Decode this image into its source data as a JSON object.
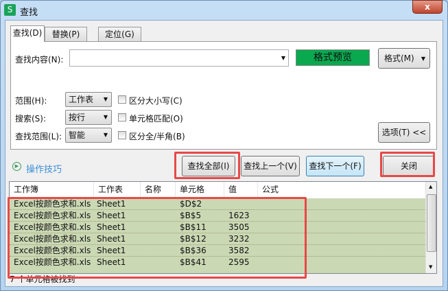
{
  "window": {
    "title": "查找",
    "logo": "S",
    "close": "x"
  },
  "tabs": [
    {
      "label": "查找(D)"
    },
    {
      "label": "替换(P)"
    },
    {
      "label": "定位(G)"
    }
  ],
  "find": {
    "label": "查找内容(N):",
    "value": "",
    "preview": "格式预览",
    "format_button": "格式(M)",
    "preview_color": "#0aa84f"
  },
  "options": [
    {
      "label": "范围(H):",
      "select": "工作表",
      "checkbox": "区分大小写(C)",
      "checked": false
    },
    {
      "label": "搜索(S):",
      "select": "按行",
      "checkbox": "单元格匹配(O)",
      "checked": false
    },
    {
      "label": "查找范围(L):",
      "select": "智能",
      "checkbox": "区分全/半角(B)",
      "checked": false
    }
  ],
  "options_button": "选项(T) <<",
  "help_link": "操作技巧",
  "buttons": {
    "find_all": "查找全部(I)",
    "find_prev": "查找上一个(V)",
    "find_next": "查找下一个(F)",
    "close": "关闭"
  },
  "table": {
    "headers": [
      "工作簿",
      "工作表",
      "名称",
      "单元格",
      "值",
      "公式"
    ],
    "rows": [
      [
        "Excel按颜色求和.xls",
        "Sheet1",
        "",
        "$D$2",
        "",
        ""
      ],
      [
        "Excel按颜色求和.xls",
        "Sheet1",
        "",
        "$B$5",
        "1623",
        ""
      ],
      [
        "Excel按颜色求和.xls",
        "Sheet1",
        "",
        "$B$11",
        "3505",
        ""
      ],
      [
        "Excel按颜色求和.xls",
        "Sheet1",
        "",
        "$B$12",
        "3232",
        ""
      ],
      [
        "Excel按颜色求和.xls",
        "Sheet1",
        "",
        "$B$36",
        "3582",
        ""
      ],
      [
        "Excel按颜色求和.xls",
        "Sheet1",
        "",
        "$B$41",
        "2595",
        ""
      ]
    ]
  },
  "status": "7 个单元格被找到",
  "highlight_color": "#e84848"
}
